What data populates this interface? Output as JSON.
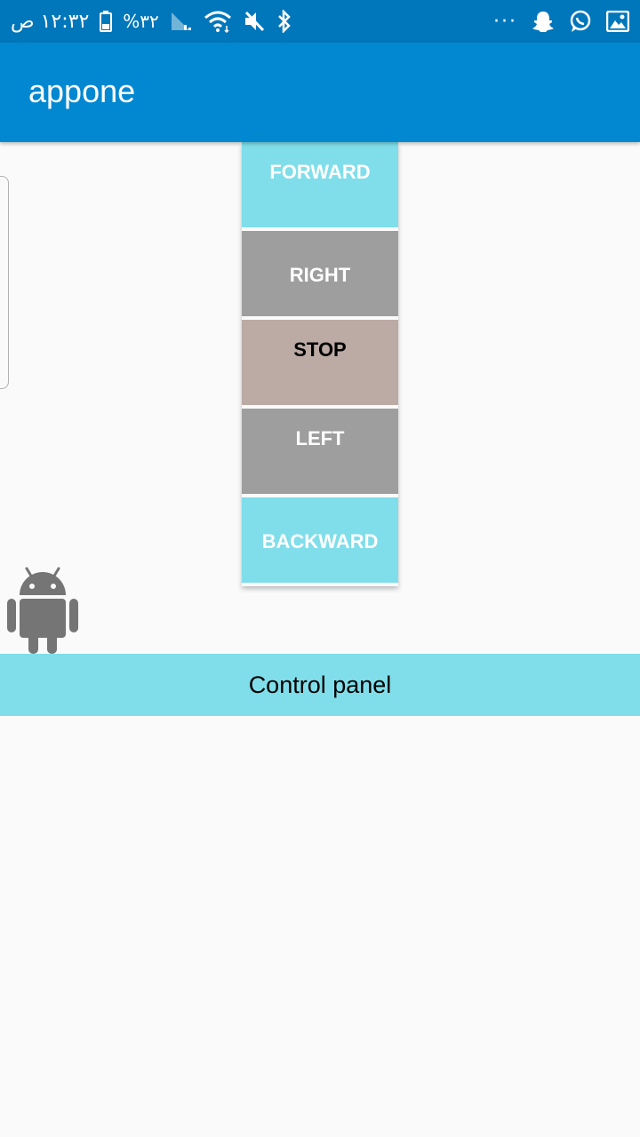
{
  "status_bar": {
    "time": "١٢:٣٢ ص",
    "battery": "%٣٢",
    "icons": [
      "battery-icon",
      "signal-icon",
      "wifi-icon",
      "mute-icon",
      "bluetooth-icon",
      "more-dots-icon",
      "snapchat-icon",
      "whatsapp-icon",
      "gallery-icon"
    ],
    "more": "···"
  },
  "app_bar": {
    "title": "appone"
  },
  "controls": {
    "forward": "FORWARD",
    "right": "RIGHT",
    "stop": "STOP",
    "left": "LEFT",
    "backward": "BACKWARD"
  },
  "panel": {
    "label": "Control panel"
  },
  "colors": {
    "status_bar": "#0077ba",
    "app_bar": "#0288d1",
    "accent_cyan": "#80deea",
    "grey_button": "#9e9e9e",
    "stop_button": "#bcaaa4",
    "android_grey": "#757575"
  }
}
